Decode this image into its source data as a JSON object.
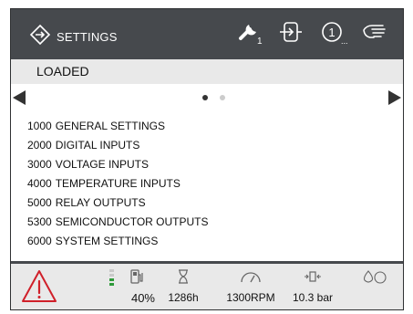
{
  "header": {
    "title": "SETTINGS",
    "wrench_sub": "1",
    "info_sub": "1..."
  },
  "status": {
    "text": "LOADED"
  },
  "pager": {
    "pages": 2,
    "current": 1
  },
  "menu": {
    "items": [
      {
        "code": "1000",
        "label": "GENERAL SETTINGS"
      },
      {
        "code": "2000",
        "label": "DIGITAL INPUTS"
      },
      {
        "code": "3000",
        "label": "VOLTAGE INPUTS"
      },
      {
        "code": "4000",
        "label": "TEMPERATURE INPUTS"
      },
      {
        "code": "5000",
        "label": "RELAY OUTPUTS"
      },
      {
        "code": "5300",
        "label": "SEMICONDUCTOR OUTPUTS"
      },
      {
        "code": "6000",
        "label": "SYSTEM SETTINGS"
      }
    ]
  },
  "footer": {
    "fuel": "40%",
    "hours": "1286h",
    "rpm": "1300RPM",
    "pressure": "10.3 bar"
  },
  "colors": {
    "header_bg": "#46494d",
    "alarm_red": "#d0202a",
    "fuel_green": "#2e9a3a"
  },
  "icons": [
    "settings-icon",
    "wrench-icon",
    "input-icon",
    "info-icon",
    "hand-icon",
    "warning-icon",
    "fuel-icon",
    "hourglass-icon",
    "gauge-icon",
    "pressure-icon",
    "drops-icon"
  ]
}
